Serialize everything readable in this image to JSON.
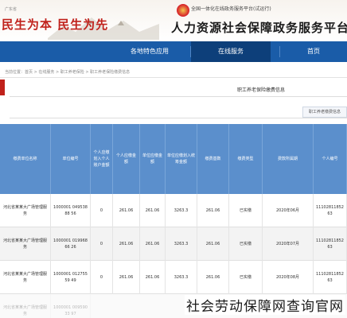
{
  "header": {
    "tiny_top": "广东省",
    "logo_text": "民生为本 民生为先",
    "sub_top": "全国一体化在线政务服务平台(试运行)",
    "main_title": "人力资源社会保障政务服务平台",
    "accent": "#c0211b"
  },
  "nav": {
    "items": [
      "首页",
      "在线服务",
      "各地特色应用"
    ],
    "active_index": 1,
    "color": "#1a5ca8"
  },
  "breadcrumb": "当前位置：首页 > 在线服务 > 职工养老保险 > 职工养老保险缴费信息",
  "section": {
    "title": "职工养老保险缴费信息",
    "tab": "职工养老缴费信息"
  },
  "table": {
    "headers": [
      "个人编号",
      "费款所属期",
      "缴费类型",
      "缴费基数",
      "单位应缴划入统筹金额",
      "单位应缴金额",
      "个人应缴金额",
      "个人应缴划入个人账户金额",
      "单位编号",
      "缴费单位名称"
    ],
    "rows": [
      {
        "personal_no": "11102811852 63",
        "period": "2020年06月",
        "type": "已实缴",
        "base": "261.06",
        "unit_pool": "3263.3",
        "unit_pay": "261.06",
        "personal_pay": "261.06",
        "personal_account": "0",
        "unit_no": "1000001 04953888 56",
        "unit_name": "河北省某某大广场管理服务"
      },
      {
        "personal_no": "11102811852 63",
        "period": "2020年07月",
        "type": "已实缴",
        "base": "261.06",
        "unit_pool": "3263.3",
        "unit_pay": "261.06",
        "personal_pay": "261.06",
        "personal_account": "0",
        "unit_no": "1000001 01996866 26",
        "unit_name": "河北省某某大广场管理服务"
      },
      {
        "personal_no": "11102811852 63",
        "period": "2020年08月",
        "type": "已实缴",
        "base": "261.06",
        "unit_pool": "3263.3",
        "unit_pay": "261.06",
        "personal_pay": "261.06",
        "personal_account": "0",
        "unit_no": "1000001 01275559 49",
        "unit_name": "河北省某某大广场管理服务"
      },
      {
        "personal_no": "",
        "period": "",
        "type": "",
        "base": "",
        "unit_pool": "",
        "unit_pay": "",
        "personal_pay": "",
        "personal_account": "",
        "unit_no": "1000001 00959033 97",
        "unit_name": "河北省某某大广场管理服务"
      }
    ]
  },
  "watermark": "社会劳动保障网查询官网"
}
